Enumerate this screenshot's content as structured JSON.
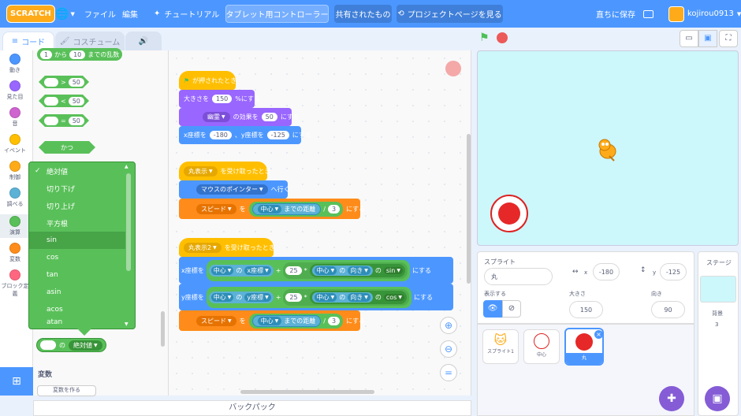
{
  "topbar": {
    "logo": "SCRATCH",
    "file": "ファイル",
    "edit": "編集",
    "tutorials": "チュートリアル",
    "project_title": "タブレット用コントローラー",
    "shared": "共有されたもの",
    "project_page": "プロジェクトページを見る",
    "save_now": "直ちに保存",
    "username": "kojirou0913"
  },
  "tabs": {
    "code": "コード",
    "costumes": "コスチューム",
    "sounds": ""
  },
  "categories": [
    {
      "label": "動き",
      "color": "#4c97ff"
    },
    {
      "label": "見た目",
      "color": "#9966ff"
    },
    {
      "label": "音",
      "color": "#cf63cf"
    },
    {
      "label": "イベント",
      "color": "#ffbf00"
    },
    {
      "label": "制御",
      "color": "#ffab19"
    },
    {
      "label": "調べる",
      "color": "#5cb1d6"
    },
    {
      "label": "演算",
      "color": "#59c059"
    },
    {
      "label": "変数",
      "color": "#ff8c1a"
    },
    {
      "label": "ブロック定義",
      "color": "#ff6680"
    }
  ],
  "palette": {
    "random_from": "1",
    "random_to": "10",
    "random_text_from": "から",
    "random_text_to": "までの乱数",
    "gt": ">",
    "lt": "<",
    "eq": "=",
    "op_value": "50",
    "and": "かつ",
    "of_text": "の",
    "of_selected": "絶対値",
    "variables_title": "変数",
    "make_variable": "変数を作る"
  },
  "dropdown": {
    "items": [
      "絶対値",
      "切り下げ",
      "切り上げ",
      "平方根",
      "sin",
      "cos",
      "tan",
      "asin",
      "acos",
      "atan"
    ],
    "selected": "sin",
    "checked": "絶対値"
  },
  "script1": {
    "hat": "が押されたとき",
    "size_a": "大きさを",
    "size_v": "150",
    "size_b": "%にする",
    "effect_sel": "幽霊",
    "effect_a": "の効果を",
    "effect_v": "50",
    "effect_b": "にする",
    "goto_x_a": "x座標を",
    "goto_x": "-180",
    "goto_y_a": "、y座標を",
    "goto_y": "-125",
    "goto_b": "にする"
  },
  "script2": {
    "hat_sel": "丸表示",
    "hat_b": "を受け取ったとき",
    "goto_sel": "マウスのポインター",
    "goto_b": "へ行く",
    "var_sel": "スピード",
    "var_a": "を",
    "sensor_sel": "中心",
    "sensor_b": "までの距離",
    "div": "/",
    "div_v": "3",
    "var_b": "にする"
  },
  "script3": {
    "hat_sel": "丸表示2",
    "hat_b": "を受け取ったとき",
    "setx_a": "x座標を",
    "sety_a": "y座標を",
    "obj": "中心",
    "of": "の",
    "prop_x": "x座標",
    "prop_y": "y座標",
    "plus": "+",
    "num": "25",
    "times": "*",
    "dir": "向き",
    "fn_sin": "sin",
    "fn_cos": "cos",
    "set_b": "にする",
    "var_sel": "スピード",
    "var_a": "を",
    "sensor_b": "までの距離",
    "div": "/",
    "div_v": "3",
    "var_b": "にする"
  },
  "backpack": "バックパック",
  "sprite_info": {
    "label": "スプライト",
    "name": "丸",
    "x_label": "x",
    "x": "-180",
    "y_label": "y",
    "y": "-125",
    "show_label": "表示する",
    "size_label": "大きさ",
    "size": "150",
    "dir_label": "向き",
    "dir": "90"
  },
  "sprites": [
    {
      "name": "スプライト1"
    },
    {
      "name": "中心"
    },
    {
      "name": "丸"
    }
  ],
  "stage_panel": {
    "title": "ステージ",
    "backdrops_label": "背景",
    "backdrops_count": "3"
  }
}
